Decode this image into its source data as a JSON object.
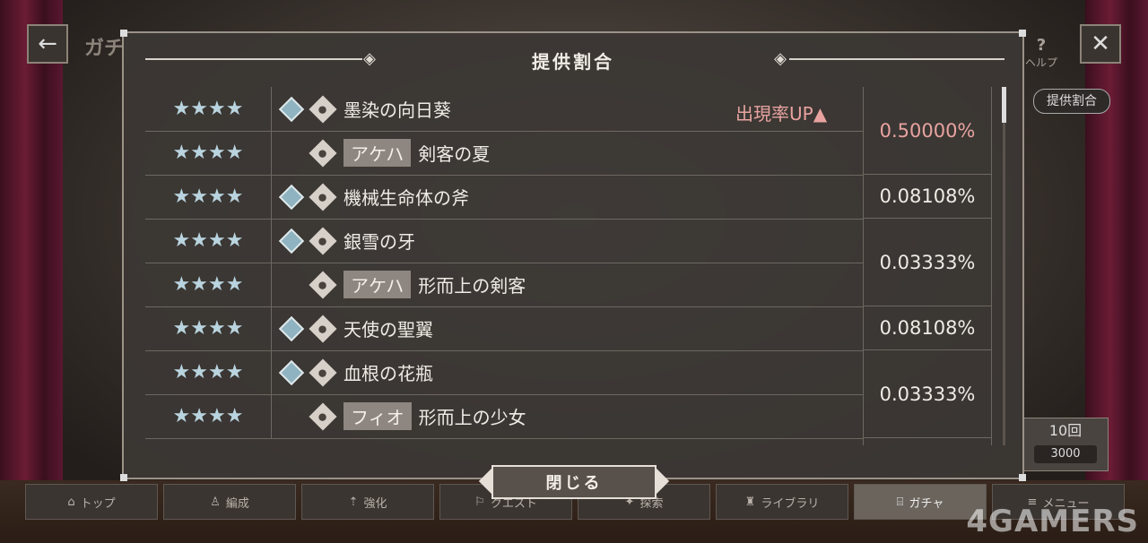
{
  "background": {
    "title": "ガチ",
    "help_label": "ヘルプ",
    "side_tab": "提供割合",
    "ten_roll": {
      "label": "10回",
      "cost": "3000"
    }
  },
  "modal": {
    "title": "提供割合",
    "rate_up_label": "出現率UP▲",
    "rows": [
      {
        "stars": "★★★★",
        "has_gem": true,
        "tag": "",
        "name": "墨染の向日葵"
      },
      {
        "stars": "★★★★",
        "has_gem": false,
        "tag": "アケハ",
        "name": "剣客の夏"
      },
      {
        "stars": "★★★★",
        "has_gem": true,
        "tag": "",
        "name": "機械生命体の斧"
      },
      {
        "stars": "★★★★",
        "has_gem": true,
        "tag": "",
        "name": "銀雪の牙"
      },
      {
        "stars": "★★★★",
        "has_gem": false,
        "tag": "アケハ",
        "name": "形而上の剣客"
      },
      {
        "stars": "★★★★",
        "has_gem": true,
        "tag": "",
        "name": "天使の聖翼"
      },
      {
        "stars": "★★★★",
        "has_gem": true,
        "tag": "",
        "name": "血根の花瓶"
      },
      {
        "stars": "★★★★",
        "has_gem": false,
        "tag": "フィオ",
        "name": "形而上の少女"
      }
    ],
    "rates": [
      "0.50000%",
      "0.08108%",
      "0.03333%",
      "0.08108%",
      "0.03333%"
    ],
    "close_label": "閉じる"
  },
  "nav": [
    "トップ",
    "編成",
    "強化",
    "クエスト",
    "探索",
    "ライブラリ",
    "ガチャ",
    "メニュー"
  ],
  "nav_active": "ガチャ",
  "watermark": "4GAMERS"
}
